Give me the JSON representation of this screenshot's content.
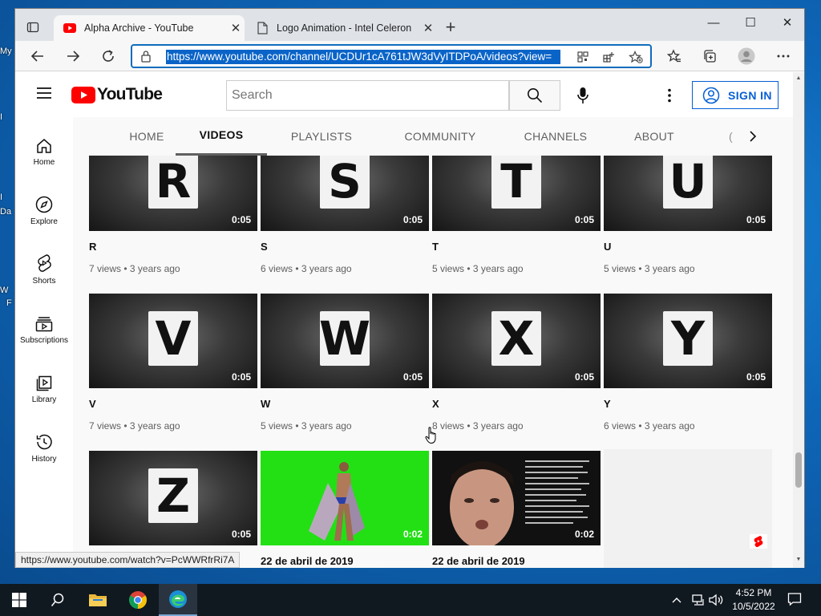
{
  "desktop": {
    "labels": [
      "My",
      "I",
      "I",
      "Da",
      "W",
      "F"
    ]
  },
  "browser": {
    "tabs": [
      {
        "title": "Alpha Archive - YouTube",
        "close": "✕"
      },
      {
        "title": "Logo Animation - Intel Celeron ",
        "close": "✕"
      }
    ],
    "new_tab": "+",
    "window_controls": {
      "minimize": "—",
      "maximize": "☐",
      "close": "✕"
    },
    "address": "https://www.youtube.com/channel/UCDUr1cA761tJW3dVyITDPoA/videos?view=",
    "status_url": "https://www.youtube.com/watch?v=PcWWRfrRi7A"
  },
  "youtube": {
    "logo_text": "YouTube",
    "search_placeholder": "Search",
    "sign_in": "SIGN IN",
    "sidebar": [
      {
        "label": "Home",
        "icon": "home-icon"
      },
      {
        "label": "Explore",
        "icon": "compass-icon"
      },
      {
        "label": "Shorts",
        "icon": "shorts-icon"
      },
      {
        "label": "Subscriptions",
        "icon": "subscriptions-icon"
      },
      {
        "label": "Library",
        "icon": "library-icon"
      },
      {
        "label": "History",
        "icon": "history-icon"
      }
    ],
    "channel_tabs": [
      "HOME",
      "VIDEOS",
      "PLAYLISTS",
      "COMMUNITY",
      "CHANNELS",
      "ABOUT"
    ],
    "active_tab": "VIDEOS",
    "videos": [
      {
        "letter": "R",
        "title": "R",
        "duration": "0:05",
        "meta": "7 views • 3 years ago"
      },
      {
        "letter": "S",
        "title": "S",
        "duration": "0:05",
        "meta": "6 views • 3 years ago"
      },
      {
        "letter": "T",
        "title": "T",
        "duration": "0:05",
        "meta": "5 views • 3 years ago"
      },
      {
        "letter": "U",
        "title": "U",
        "duration": "0:05",
        "meta": "5 views • 3 years ago"
      },
      {
        "letter": "V",
        "title": "V",
        "duration": "0:05",
        "meta": "7 views • 3 years ago"
      },
      {
        "letter": "W",
        "title": "W",
        "duration": "0:05",
        "meta": "5 views • 3 years ago"
      },
      {
        "letter": "X",
        "title": "X",
        "duration": "0:05",
        "meta": "8 views • 3 years ago"
      },
      {
        "letter": "Y",
        "title": "Y",
        "duration": "0:05",
        "meta": "6 views • 3 years ago"
      },
      {
        "letter": "Z",
        "title": "",
        "duration": "0:05",
        "meta": ""
      },
      {
        "letter": "",
        "title": "22 de abril de 2019",
        "duration": "0:02",
        "meta": ""
      },
      {
        "letter": "",
        "title": "22 de abril de 2019",
        "duration": "0:02",
        "meta": ""
      }
    ]
  },
  "taskbar": {
    "clock_time": "4:52 PM",
    "clock_date": "10/5/2022"
  },
  "colors": {
    "youtube_red": "#ff0000",
    "link_blue": "#065fd4",
    "edge_accent": "#0f6cbd"
  }
}
